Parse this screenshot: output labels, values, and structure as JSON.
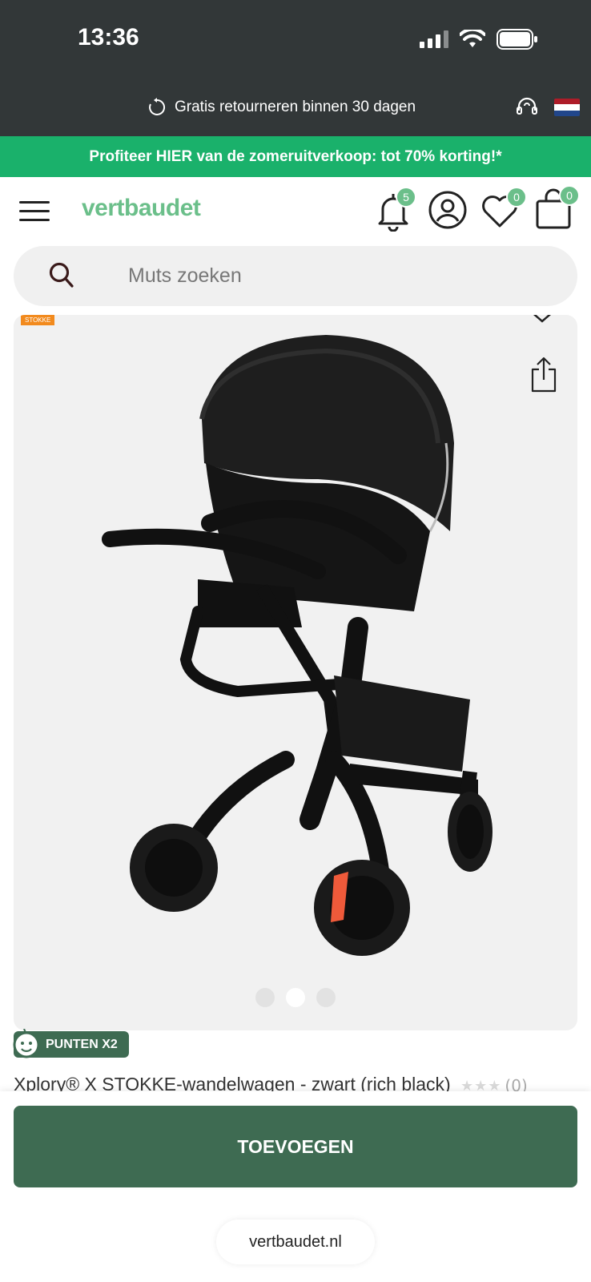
{
  "status_bar": {
    "time": "13:36"
  },
  "top_strip": {
    "return_text": "Gratis retourneren binnen 30 dagen"
  },
  "promo": {
    "text": "Profiteer HIER van de zomeruitverkoop: tot 70% korting!*"
  },
  "header": {
    "logo": "vertbaudet",
    "notifications_count": "5",
    "wishlist_count": "0",
    "cart_count": "0"
  },
  "search": {
    "placeholder": "Muts zoeken"
  },
  "product": {
    "brand_tag": "STOKKE",
    "image_slides": 3,
    "active_slide": 2,
    "points_badge": "PUNTEN X2",
    "title": "Xplory® X STOKKE-wandelwagen - zwart (rich black)",
    "rating_count": "(0)",
    "stars": "★★★"
  },
  "actions": {
    "add_label": "TOEVOEGEN"
  },
  "browser": {
    "url": "vertbaudet.nl"
  },
  "colors": {
    "dark_bar": "#323738",
    "promo_green": "#1ab16b",
    "brand_green": "#3e6b52",
    "logo_green": "#6bbf8a",
    "brand_tag": "#f28a1d"
  },
  "icons": [
    "signal-icon",
    "wifi-icon",
    "battery-icon",
    "refresh-icon",
    "support-icon",
    "flag-nl-icon",
    "menu-icon",
    "bell-icon",
    "account-icon",
    "heart-icon",
    "bag-icon",
    "search-icon",
    "chevron-down-icon",
    "share-icon",
    "baby-icon",
    "star-icon"
  ]
}
